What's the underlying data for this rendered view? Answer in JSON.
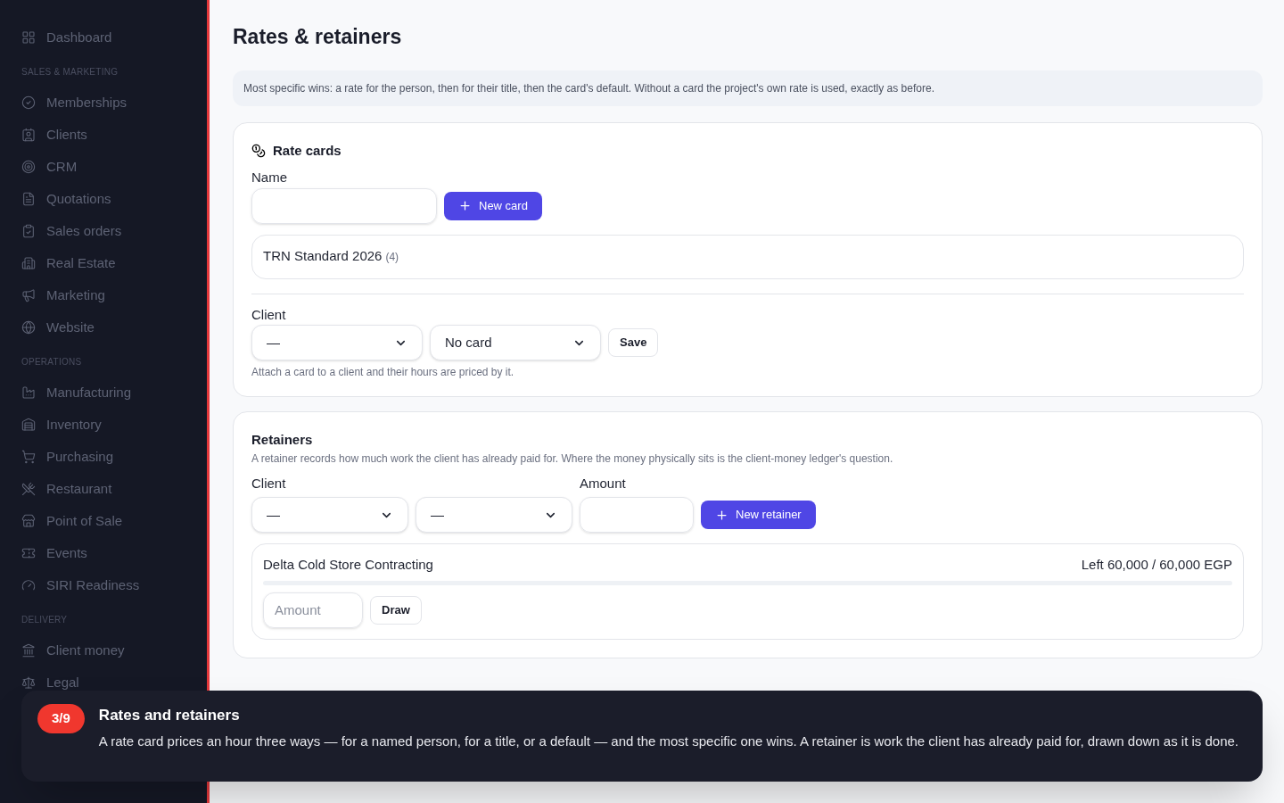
{
  "sidebar": {
    "items": [
      {
        "kind": "link",
        "label": "Dashboard"
      },
      {
        "kind": "section",
        "label": "SALES & MARKETING"
      },
      {
        "kind": "link",
        "label": "Memberships"
      },
      {
        "kind": "link",
        "label": "Clients"
      },
      {
        "kind": "link",
        "label": "CRM"
      },
      {
        "kind": "link",
        "label": "Quotations"
      },
      {
        "kind": "link",
        "label": "Sales orders"
      },
      {
        "kind": "link",
        "label": "Real Estate"
      },
      {
        "kind": "link",
        "label": "Marketing"
      },
      {
        "kind": "link",
        "label": "Website"
      },
      {
        "kind": "section",
        "label": "OPERATIONS"
      },
      {
        "kind": "link",
        "label": "Manufacturing"
      },
      {
        "kind": "link",
        "label": "Inventory"
      },
      {
        "kind": "link",
        "label": "Purchasing"
      },
      {
        "kind": "link",
        "label": "Restaurant"
      },
      {
        "kind": "link",
        "label": "Point of Sale"
      },
      {
        "kind": "link",
        "label": "Events"
      },
      {
        "kind": "link",
        "label": "SIRI Readiness"
      },
      {
        "kind": "section",
        "label": "DELIVERY"
      },
      {
        "kind": "link",
        "label": "Client money"
      },
      {
        "kind": "link",
        "label": "Legal"
      }
    ]
  },
  "page": {
    "title": "Rates & retainers",
    "note": "Most specific wins: a rate for the person, then for their title, then the card's default. Without a card the project's own rate is used, exactly as before."
  },
  "rate_cards": {
    "title": "Rate cards",
    "name_label": "Name",
    "new_button": "New card",
    "cards": [
      {
        "name": "TRN Standard 2026",
        "count": "(4)"
      }
    ],
    "client_label": "Client",
    "client_select": "—",
    "card_select": "No card",
    "save_button": "Save",
    "hint": "Attach a card to a client and their hours are priced by it."
  },
  "retainers": {
    "title": "Retainers",
    "description": "A retainer records how much work the client has already paid for. Where the money physically sits is the client-money ledger's question.",
    "client_label": "Client",
    "amount_label": "Amount",
    "client_select": "—",
    "second_select": "—",
    "new_button": "New retainer",
    "items": [
      {
        "client": "Delta Cold Store Contracting",
        "left": "Left 60,000 / 60,000 EGP",
        "level": 0,
        "amount_placeholder": "Amount",
        "draw_button": "Draw"
      }
    ]
  },
  "tour": {
    "step": "3/9",
    "title": "Rates and retainers",
    "body": "A rate card prices an hour three ways — for a named person, for a title, or a default — and the most specific one wins. A retainer is work the client has already paid for, drawn down as it is done."
  }
}
